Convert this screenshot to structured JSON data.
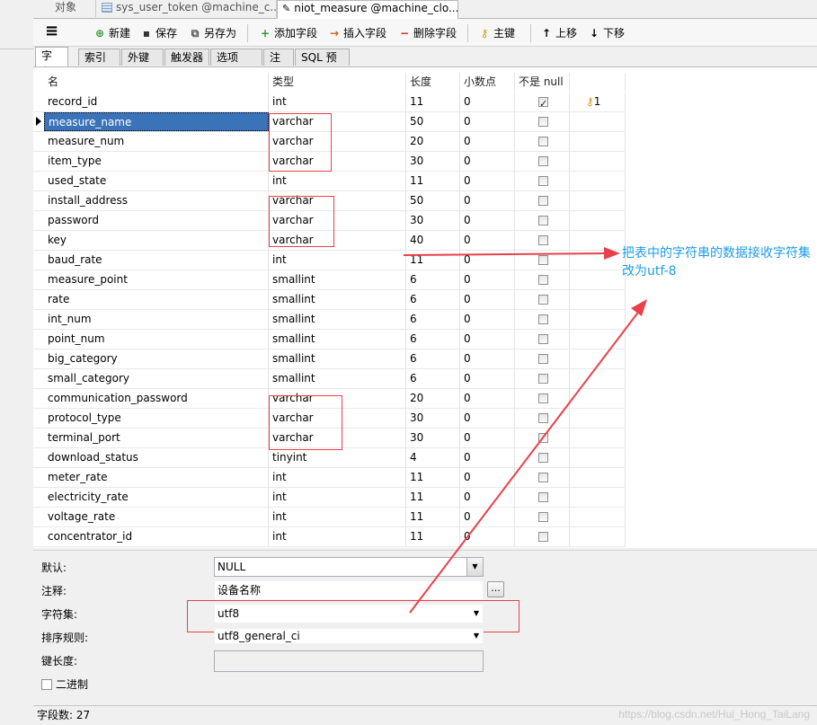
{
  "doc_tabs": [
    {
      "label": "对象",
      "icon": "none",
      "active": false
    },
    {
      "label": "sys_user_token @machine_c...",
      "icon": "table-icon",
      "active": false
    },
    {
      "label": "niot_measure @machine_clo...",
      "icon": "edit-icon",
      "active": true
    }
  ],
  "toolbar": {
    "menu_icon": "hamburger-icon",
    "new_label": "新建",
    "save_label": "保存",
    "save_as_label": "另存为",
    "add_field_label": "添加字段",
    "insert_field_label": "插入字段",
    "delete_field_label": "删除字段",
    "primary_key_label": "主键",
    "move_up_label": "上移",
    "move_down_label": "下移"
  },
  "sub_tabs": [
    "字段",
    "索引",
    "外键",
    "触发器",
    "选项",
    "注释",
    "SQL 预览"
  ],
  "grid": {
    "headers": {
      "name": "名",
      "type": "类型",
      "length": "长度",
      "decimals": "小数点",
      "not_null": "不是 null"
    },
    "rows": [
      {
        "name": "record_id",
        "type": "int",
        "length": "11",
        "decimals": "0",
        "not_null": true,
        "key": "1"
      },
      {
        "name": "measure_name",
        "type": "varchar",
        "length": "50",
        "decimals": "0",
        "not_null": false,
        "key": ""
      },
      {
        "name": "measure_num",
        "type": "varchar",
        "length": "20",
        "decimals": "0",
        "not_null": false,
        "key": ""
      },
      {
        "name": "item_type",
        "type": "varchar",
        "length": "30",
        "decimals": "0",
        "not_null": false,
        "key": ""
      },
      {
        "name": "used_state",
        "type": "int",
        "length": "11",
        "decimals": "0",
        "not_null": false,
        "key": ""
      },
      {
        "name": "install_address",
        "type": "varchar",
        "length": "50",
        "decimals": "0",
        "not_null": false,
        "key": ""
      },
      {
        "name": "password",
        "type": "varchar",
        "length": "30",
        "decimals": "0",
        "not_null": false,
        "key": ""
      },
      {
        "name": "key",
        "type": "varchar",
        "length": "40",
        "decimals": "0",
        "not_null": false,
        "key": ""
      },
      {
        "name": "baud_rate",
        "type": "int",
        "length": "11",
        "decimals": "0",
        "not_null": false,
        "key": ""
      },
      {
        "name": "measure_point",
        "type": "smallint",
        "length": "6",
        "decimals": "0",
        "not_null": false,
        "key": ""
      },
      {
        "name": "rate",
        "type": "smallint",
        "length": "6",
        "decimals": "0",
        "not_null": false,
        "key": ""
      },
      {
        "name": "int_num",
        "type": "smallint",
        "length": "6",
        "decimals": "0",
        "not_null": false,
        "key": ""
      },
      {
        "name": "point_num",
        "type": "smallint",
        "length": "6",
        "decimals": "0",
        "not_null": false,
        "key": ""
      },
      {
        "name": "big_category",
        "type": "smallint",
        "length": "6",
        "decimals": "0",
        "not_null": false,
        "key": ""
      },
      {
        "name": "small_category",
        "type": "smallint",
        "length": "6",
        "decimals": "0",
        "not_null": false,
        "key": ""
      },
      {
        "name": "communication_password",
        "type": "varchar",
        "length": "20",
        "decimals": "0",
        "not_null": false,
        "key": ""
      },
      {
        "name": "protocol_type",
        "type": "varchar",
        "length": "30",
        "decimals": "0",
        "not_null": false,
        "key": ""
      },
      {
        "name": "terminal_port",
        "type": "varchar",
        "length": "30",
        "decimals": "0",
        "not_null": false,
        "key": ""
      },
      {
        "name": "download_status",
        "type": "tinyint",
        "length": "4",
        "decimals": "0",
        "not_null": false,
        "key": ""
      },
      {
        "name": "meter_rate",
        "type": "int",
        "length": "11",
        "decimals": "0",
        "not_null": false,
        "key": ""
      },
      {
        "name": "electricity_rate",
        "type": "int",
        "length": "11",
        "decimals": "0",
        "not_null": false,
        "key": ""
      },
      {
        "name": "voltage_rate",
        "type": "int",
        "length": "11",
        "decimals": "0",
        "not_null": false,
        "key": ""
      },
      {
        "name": "concentrator_id",
        "type": "int",
        "length": "11",
        "decimals": "0",
        "not_null": false,
        "key": ""
      }
    ]
  },
  "properties": {
    "default_label": "默认:",
    "default_value": "NULL",
    "comment_label": "注释:",
    "comment_value": "设备名称",
    "comment_button": "...",
    "charset_label": "字符集:",
    "charset_value": "utf8",
    "collation_label": "排序规则:",
    "collation_value": "utf8_general_ci",
    "key_length_label": "键长度:",
    "key_length_value": "",
    "binary_label": "二进制"
  },
  "status": {
    "field_count": "字段数: 27"
  },
  "annotation": {
    "text": "把表中的字符串的数据接收字符集改为utf-8"
  },
  "watermark": "https://blog.csdn.net/Hui_Hong_TaiLang",
  "colors": {
    "annotation_red": "#e8414a",
    "annotation_blue": "#1e9be8",
    "selection": "#3b73b9"
  }
}
